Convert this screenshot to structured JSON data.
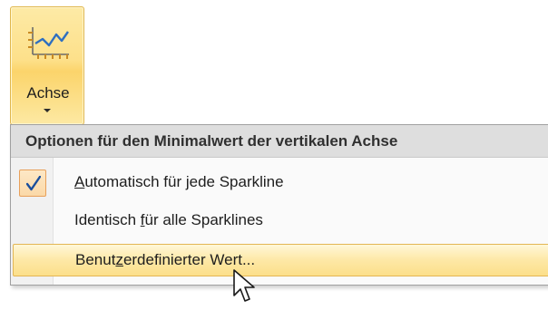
{
  "ribbon": {
    "axis_button_label": "Achse"
  },
  "menu": {
    "header": "Optionen für den Minimalwert der vertikalen Achse",
    "items": [
      {
        "pre": "",
        "accel": "A",
        "post": "utomatisch für jede Sparkline",
        "checked": true
      },
      {
        "pre": "Identisch ",
        "accel": "f",
        "post": "ür alle Sparklines",
        "checked": false
      },
      {
        "pre": "Benut",
        "accel": "z",
        "post": "erdefinierter Wert...",
        "checked": false,
        "hovered": true
      }
    ]
  },
  "icons": {
    "axis": "axis-sparkline-icon",
    "check": "check-icon",
    "cursor": "mouse-pointer-icon"
  },
  "colors": {
    "highlight_border": "#e3b654",
    "highlight_fill": "#fde8a6",
    "check_color": "#1a4e9c"
  }
}
